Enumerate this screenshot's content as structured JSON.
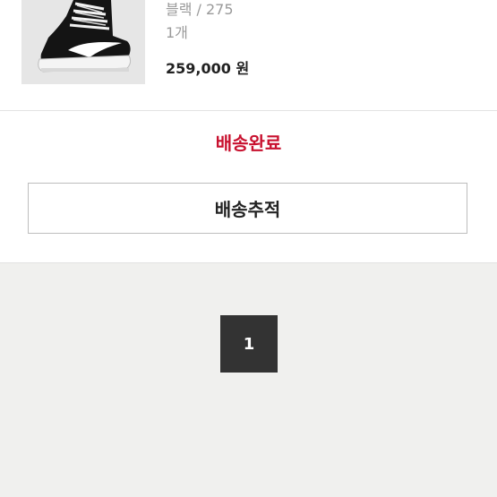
{
  "order": {
    "product": {
      "option": "블랙 / 275",
      "quantity": "1개",
      "price": "259,000 원"
    },
    "status": "배송완료",
    "track_button_label": "배송추적"
  },
  "pagination": {
    "current_page": "1"
  },
  "colors": {
    "status_red": "#c8102e",
    "page_button_bg": "#333333",
    "page_background": "#f0f0ee"
  }
}
